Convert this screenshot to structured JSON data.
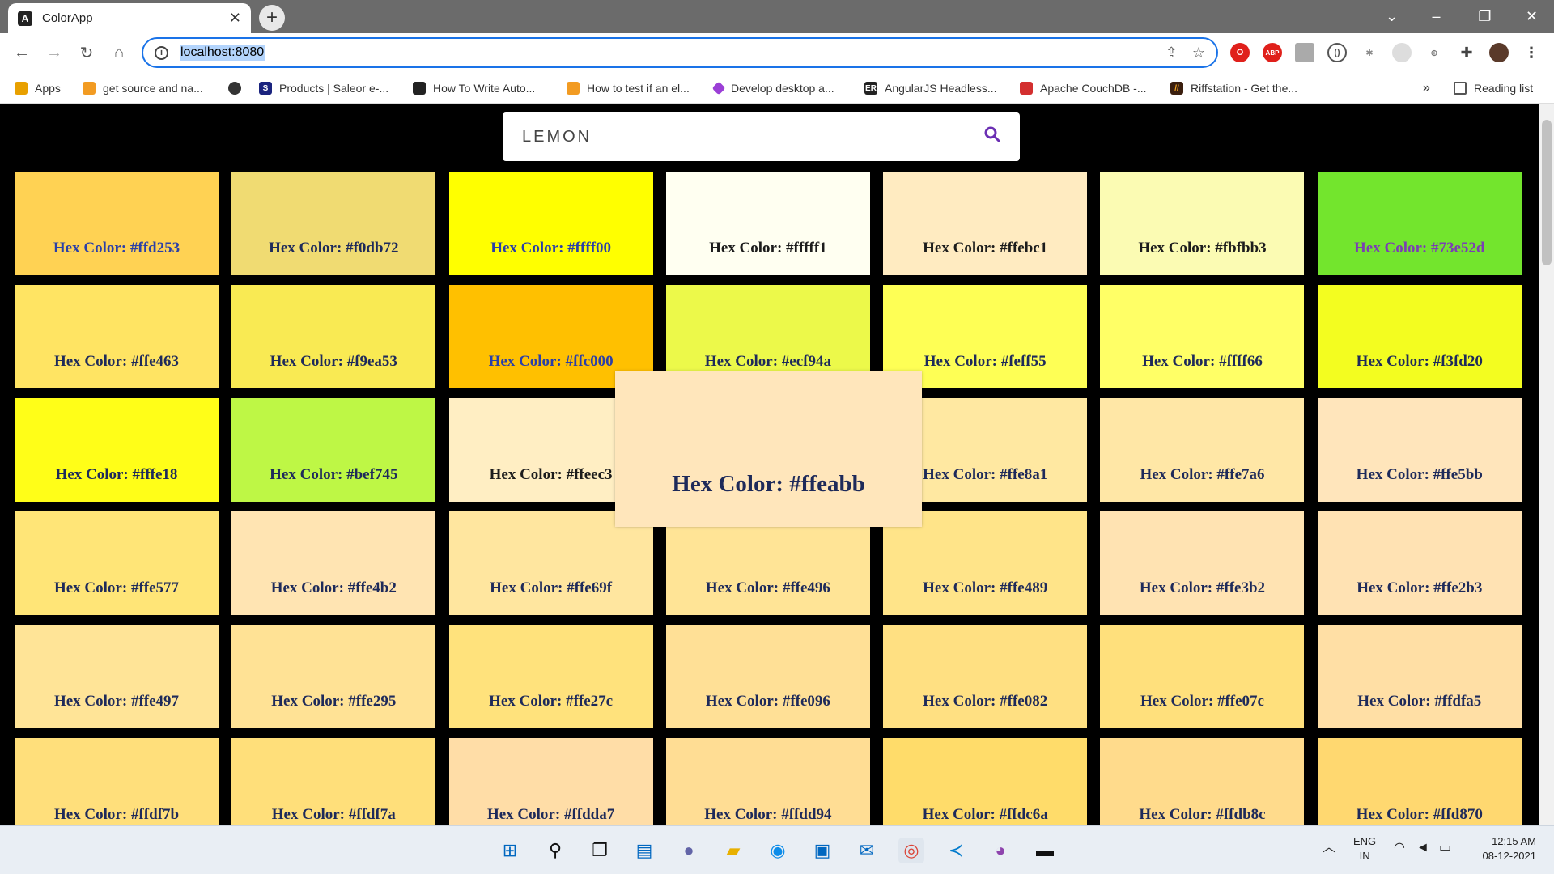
{
  "browser": {
    "tab_title": "ColorApp",
    "tab_favicon": "A",
    "new_tab_symbol": "+",
    "url": "localhost:8080",
    "reading_list": "Reading list",
    "more_bookmarks": "»"
  },
  "bookmarks": [
    {
      "label": "Apps",
      "icon": "apps-grid-icon"
    },
    {
      "label": "get source and na...",
      "icon": "bookmark-icon"
    },
    {
      "label": "",
      "icon": "globe-icon"
    },
    {
      "label": "Products | Saleor e-...",
      "icon": "saleor-icon"
    },
    {
      "label": "How To Write Auto...",
      "icon": "bookmark-icon"
    },
    {
      "label": "How to test if an el...",
      "icon": "bookmark-icon"
    },
    {
      "label": "Develop desktop a...",
      "icon": "bookmark-icon"
    },
    {
      "label": "AngularJS Headless...",
      "icon": "bookmark-icon"
    },
    {
      "label": "Apache CouchDB -...",
      "icon": "couchdb-icon"
    },
    {
      "label": "Riffstation - Get the...",
      "icon": "riffstation-icon"
    }
  ],
  "search": {
    "value": "LEMON"
  },
  "tile_prefix": "Hex Color: ",
  "tiles": [
    {
      "hex": "#ffd253",
      "text_style": "blue"
    },
    {
      "hex": "#f0db72",
      "text_style": "normal"
    },
    {
      "hex": "#ffff00",
      "text_style": "blue"
    },
    {
      "hex": "#fffff1",
      "text_style": "dark"
    },
    {
      "hex": "#ffebc1",
      "text_style": "dark"
    },
    {
      "hex": "#fbfbb3",
      "text_style": "dark"
    },
    {
      "hex": "#73e52d",
      "text_style": "purple"
    },
    {
      "hex": "#ffe463",
      "text_style": "normal"
    },
    {
      "hex": "#f9ea53",
      "text_style": "normal"
    },
    {
      "hex": "#ffc000",
      "text_style": "blue"
    },
    {
      "hex": "#ecf94a",
      "text_style": "normal"
    },
    {
      "hex": "#feff55",
      "text_style": "normal"
    },
    {
      "hex": "#ffff66",
      "text_style": "normal"
    },
    {
      "hex": "#f3fd20",
      "text_style": "normal"
    },
    {
      "hex": "#fffe18",
      "text_style": "normal"
    },
    {
      "hex": "#bef745",
      "text_style": "normal"
    },
    {
      "hex": "#ffeec3",
      "text_style": "dark"
    },
    {
      "hex": "#ffeabb",
      "text_style": "normal"
    },
    {
      "hex": "#ffe8a1",
      "text_style": "normal"
    },
    {
      "hex": "#ffe7a6",
      "text_style": "normal"
    },
    {
      "hex": "#ffe5bb",
      "text_style": "normal"
    },
    {
      "hex": "#ffe577",
      "text_style": "normal"
    },
    {
      "hex": "#ffe4b2",
      "text_style": "normal"
    },
    {
      "hex": "#ffe69f",
      "text_style": "normal"
    },
    {
      "hex": "#ffe496",
      "text_style": "normal"
    },
    {
      "hex": "#ffe489",
      "text_style": "normal"
    },
    {
      "hex": "#ffe3b2",
      "text_style": "normal"
    },
    {
      "hex": "#ffe2b3",
      "text_style": "normal"
    },
    {
      "hex": "#ffe497",
      "text_style": "normal"
    },
    {
      "hex": "#ffe295",
      "text_style": "normal"
    },
    {
      "hex": "#ffe27c",
      "text_style": "normal"
    },
    {
      "hex": "#ffe096",
      "text_style": "normal"
    },
    {
      "hex": "#ffe082",
      "text_style": "normal"
    },
    {
      "hex": "#ffe07c",
      "text_style": "normal"
    },
    {
      "hex": "#ffdfa5",
      "text_style": "normal"
    },
    {
      "hex": "#ffdf7b",
      "text_style": "normal"
    },
    {
      "hex": "#ffdf7a",
      "text_style": "normal"
    },
    {
      "hex": "#ffdda7",
      "text_style": "normal"
    },
    {
      "hex": "#ffdd94",
      "text_style": "normal"
    },
    {
      "hex": "#ffdc6a",
      "text_style": "normal"
    },
    {
      "hex": "#ffdb8c",
      "text_style": "normal"
    },
    {
      "hex": "#ffd870",
      "text_style": "normal"
    }
  ],
  "popup": {
    "label": "Hex Color: #ffeabb",
    "color": "#ffe6bb"
  },
  "taskbar": {
    "language": "ENG",
    "region": "IN",
    "time": "12:15 AM",
    "date": "08-12-2021"
  }
}
